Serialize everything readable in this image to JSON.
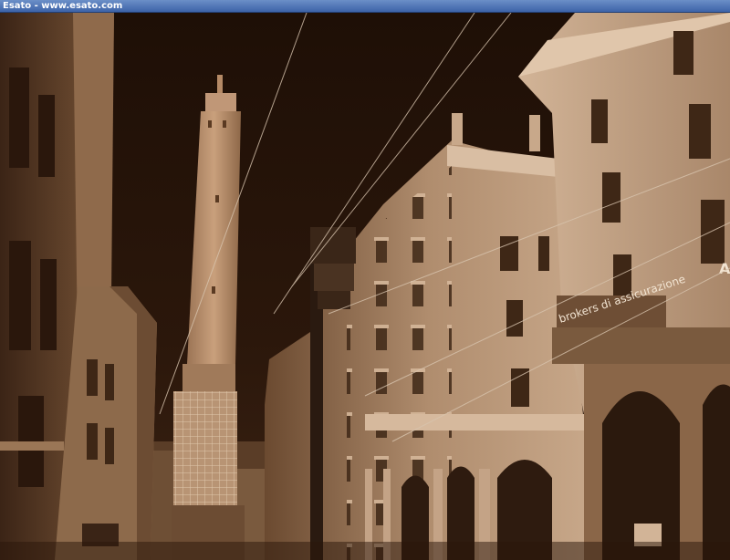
{
  "window": {
    "title": "Esato - www.esato.com"
  },
  "photo": {
    "tone": "sepia",
    "colors": {
      "sky": "#2a1509",
      "tower": "#b58a66",
      "building_light": "#c29f80",
      "building_dark": "#5a3a22"
    },
    "shop_sign": "brokers di assicurazione",
    "corner_letter": "A"
  }
}
